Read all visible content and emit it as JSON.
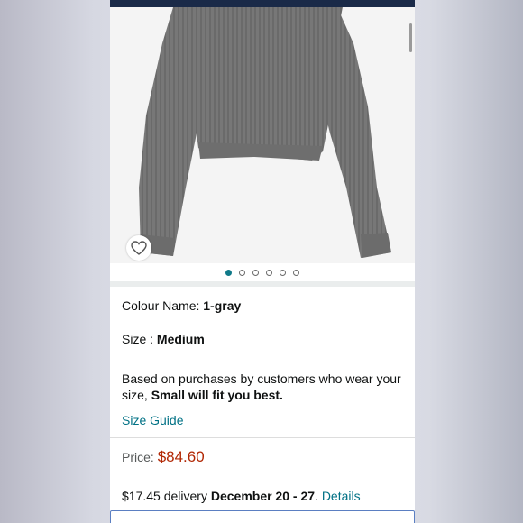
{
  "product": {
    "colour_label": "Colour Name: ",
    "colour_value": "1-gray",
    "size_label": "Size : ",
    "size_value": "Medium",
    "fit_text": "Based on purchases by customers who wear your size, ",
    "fit_bold": "Small will fit you best.",
    "size_guide": "Size Guide",
    "price_label": "Price: ",
    "price_value": "$84.60",
    "delivery_prefix": "$17.45 delivery ",
    "delivery_dates": "December 20 - 27",
    "delivery_period": ". ",
    "details_link": "Details"
  },
  "carousel": {
    "total_dots": 6,
    "active_index": 0
  },
  "colors": {
    "accent": "#007185",
    "price": "#B12704",
    "header": "#1A2A48"
  },
  "icons": {
    "wishlist": "heart-icon"
  }
}
